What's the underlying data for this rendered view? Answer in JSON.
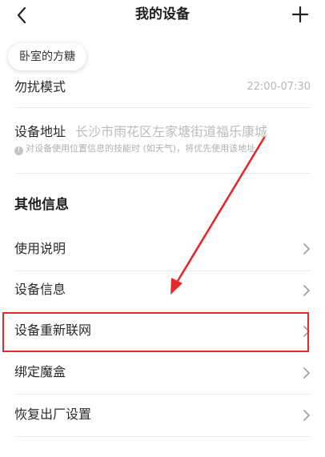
{
  "header": {
    "title": "我的设备"
  },
  "device_chip": {
    "label": "卧室的方糖"
  },
  "dnd": {
    "label": "勿扰模式",
    "value": "22:00-07:30"
  },
  "address": {
    "label": "设备地址",
    "value": "长沙市雨花区左家塘街道福乐康城",
    "note": "对设备使用位置信息的技能时 (如天气)，将优先使用该地址"
  },
  "other_info": {
    "title": "其他信息",
    "items": [
      {
        "label": "使用说明"
      },
      {
        "label": "设备信息"
      },
      {
        "label": "设备重新联网"
      },
      {
        "label": "绑定魔盒"
      },
      {
        "label": "恢复出厂设置"
      }
    ]
  },
  "colors": {
    "highlight": "#e62828",
    "divider": "#ececec",
    "secondary_text": "#b8b8b8"
  },
  "icons": {
    "back": "chevron-left-icon",
    "add": "plus-icon",
    "row_arrow": "chevron-right-icon",
    "info": "info-icon"
  }
}
